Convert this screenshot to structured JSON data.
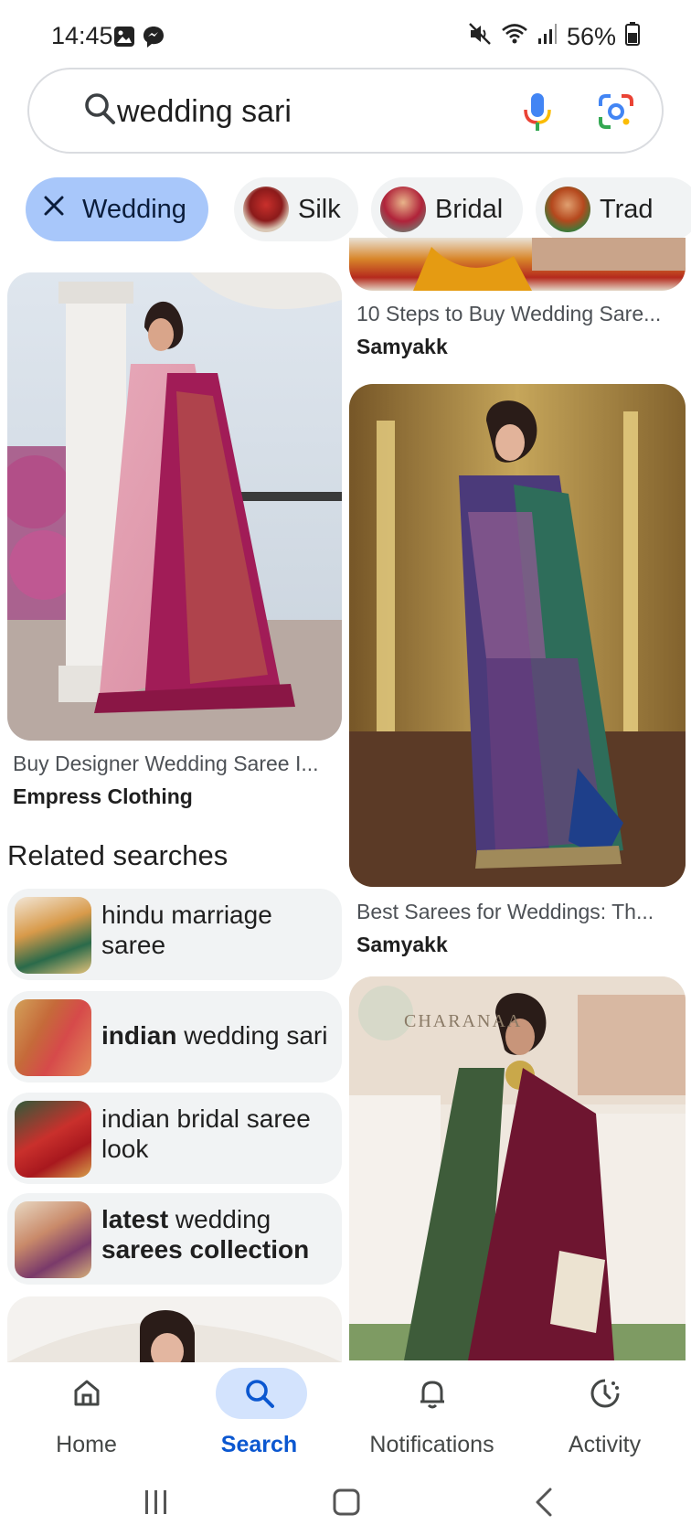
{
  "status_bar": {
    "time": "14:45",
    "battery": "56%",
    "icons": [
      "gallery-icon",
      "messenger-icon",
      "mute-icon",
      "wifi-icon",
      "signal-icon",
      "battery-icon"
    ]
  },
  "search": {
    "query": "wedding sari",
    "icons": [
      "search-icon",
      "mic-icon",
      "lens-icon"
    ]
  },
  "chips": [
    {
      "label": "Wedding",
      "active": true,
      "icon": "close-icon"
    },
    {
      "label": "Silk",
      "active": false
    },
    {
      "label": "Bridal",
      "active": false
    },
    {
      "label": "Trad",
      "active": false
    }
  ],
  "results": [
    {
      "title": "10 Steps to Buy Wedding Sare...",
      "source": "Samyakk"
    },
    {
      "title": "Buy Designer Wedding Saree I...",
      "source": "Empress Clothing"
    },
    {
      "title": "Best Sarees for Weddings: Th...",
      "source": "Samyakk"
    }
  ],
  "watermark": "CHARANAA",
  "related": {
    "heading": "Related searches",
    "items": [
      {
        "parts": [
          {
            "text": "hindu marriage saree",
            "bold": false
          }
        ]
      },
      {
        "parts": [
          {
            "text": "indian",
            "bold": true
          },
          {
            "text": " wedding sari",
            "bold": false
          }
        ]
      },
      {
        "parts": [
          {
            "text": "indian bridal saree look",
            "bold": false
          }
        ]
      },
      {
        "parts": [
          {
            "text": "latest",
            "bold": true
          },
          {
            "text": " wedding ",
            "bold": false
          },
          {
            "text": "sarees collection",
            "bold": true
          }
        ]
      }
    ]
  },
  "bottom_nav": {
    "items": [
      {
        "label": "Home",
        "icon": "home-icon",
        "active": false
      },
      {
        "label": "Search",
        "icon": "search-icon",
        "active": true
      },
      {
        "label": "Notifications",
        "icon": "bell-icon",
        "active": false
      },
      {
        "label": "Activity",
        "icon": "activity-icon",
        "active": false
      }
    ]
  },
  "system_nav": [
    "recents-button",
    "home-button",
    "back-button"
  ],
  "colors": {
    "accent": "#0b57d0",
    "chip_active": "#a8c7fa",
    "chip_bg": "#f1f3f4",
    "nav_pill": "#d3e3fd"
  }
}
